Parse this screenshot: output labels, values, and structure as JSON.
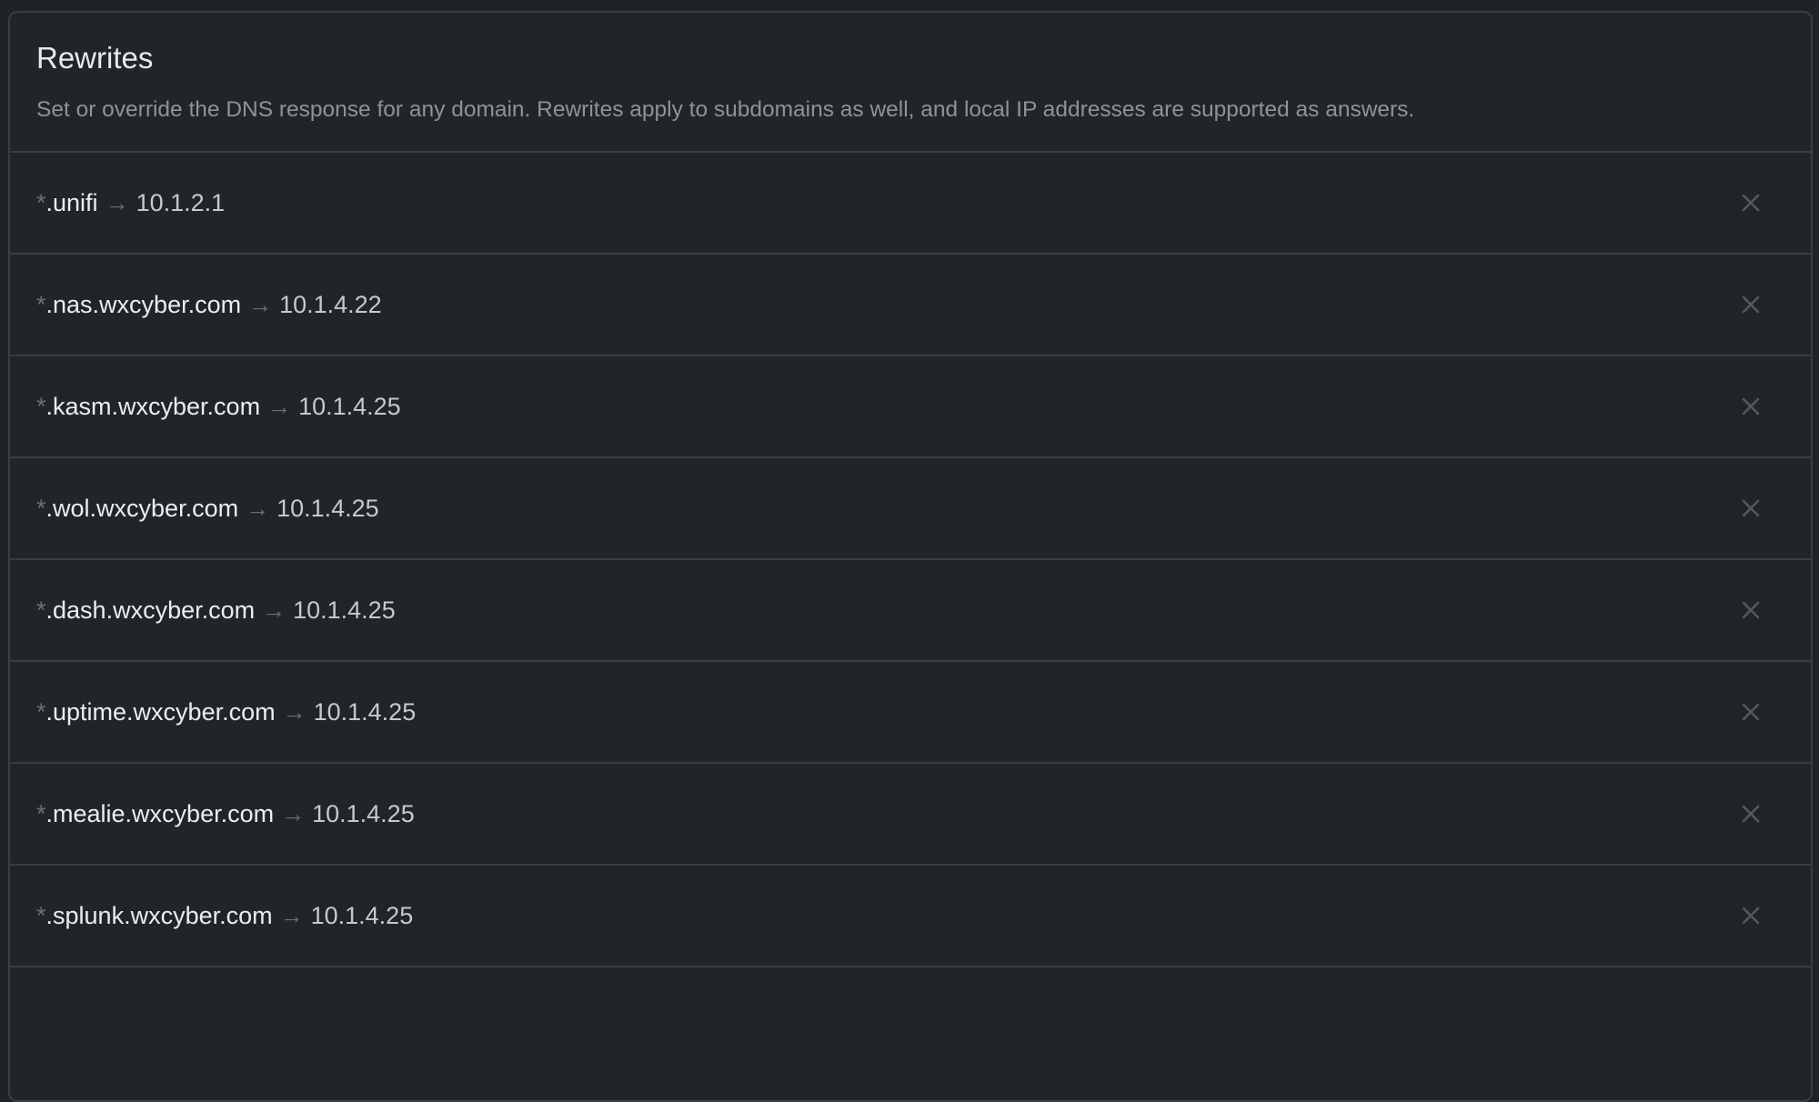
{
  "section": {
    "title": "Rewrites",
    "description": "Set or override the DNS response for any domain. Rewrites apply to subdomains as well, and local IP addresses are supported as answers."
  },
  "rewrites": [
    {
      "wildcard": "*",
      "domain": ".unifi",
      "arrow": "→",
      "answer": "10.1.2.1",
      "delete_icon": "close-icon"
    },
    {
      "wildcard": "*",
      "domain": ".nas.wxcyber.com",
      "arrow": "→",
      "answer": "10.1.4.22",
      "delete_icon": "close-icon"
    },
    {
      "wildcard": "*",
      "domain": ".kasm.wxcyber.com",
      "arrow": "→",
      "answer": "10.1.4.25",
      "delete_icon": "close-icon"
    },
    {
      "wildcard": "*",
      "domain": ".wol.wxcyber.com",
      "arrow": "→",
      "answer": "10.1.4.25",
      "delete_icon": "close-icon"
    },
    {
      "wildcard": "*",
      "domain": ".dash.wxcyber.com",
      "arrow": "→",
      "answer": "10.1.4.25",
      "delete_icon": "close-icon"
    },
    {
      "wildcard": "*",
      "domain": ".uptime.wxcyber.com",
      "arrow": "→",
      "answer": "10.1.4.25",
      "delete_icon": "close-icon"
    },
    {
      "wildcard": "*",
      "domain": ".mealie.wxcyber.com",
      "arrow": "→",
      "answer": "10.1.4.25",
      "delete_icon": "close-icon"
    },
    {
      "wildcard": "*",
      "domain": ".splunk.wxcyber.com",
      "arrow": "→",
      "answer": "10.1.4.25",
      "delete_icon": "close-icon"
    }
  ]
}
